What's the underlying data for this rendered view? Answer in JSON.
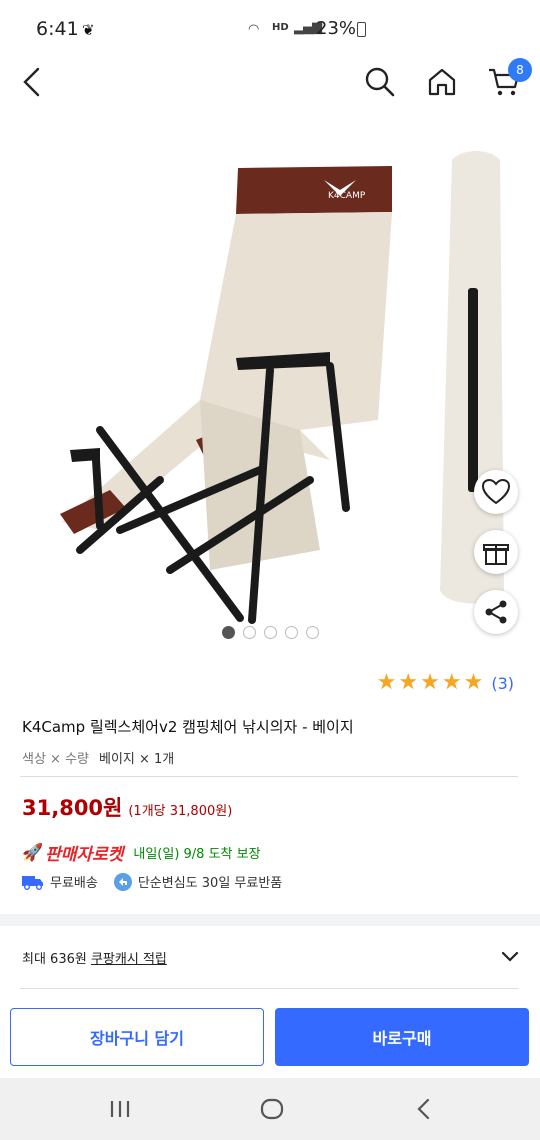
{
  "status": {
    "time": "6:41",
    "network": "HD",
    "battery": "23%"
  },
  "nav": {
    "back_icon": "chevron-left-icon",
    "search_icon": "search-icon",
    "home_icon": "home-icon",
    "cart_icon": "cart-icon",
    "cart_count": "8"
  },
  "gallery": {
    "image_count": 5,
    "active_index": 0
  },
  "rating": {
    "stars": 5,
    "count": "(3)"
  },
  "product": {
    "title": "K4Camp 릴렉스체어v2 캠핑체어 낚시의자 - 베이지",
    "option_label": "색상 × 수량",
    "option_value": "베이지 × 1개",
    "price": "31,800원",
    "unit_price": "(1개당 31,800원)"
  },
  "delivery": {
    "rocket_label": "판매자로켓",
    "eta": "내일(일) 9/8 도착 보장",
    "free_shipping": "무료배송",
    "free_return": "단순변심도 30일 무료반품"
  },
  "cash": {
    "prefix": "최대 636원 ",
    "link": "쿠팡캐시 적립"
  },
  "cta": {
    "cart_label": "장바구니 담기",
    "buy_label": "바로구매"
  },
  "colors": {
    "accent": "#346aff",
    "price": "#ae0000",
    "rocket": "#e52528",
    "eta": "#008a00",
    "star": "#f5a623"
  }
}
